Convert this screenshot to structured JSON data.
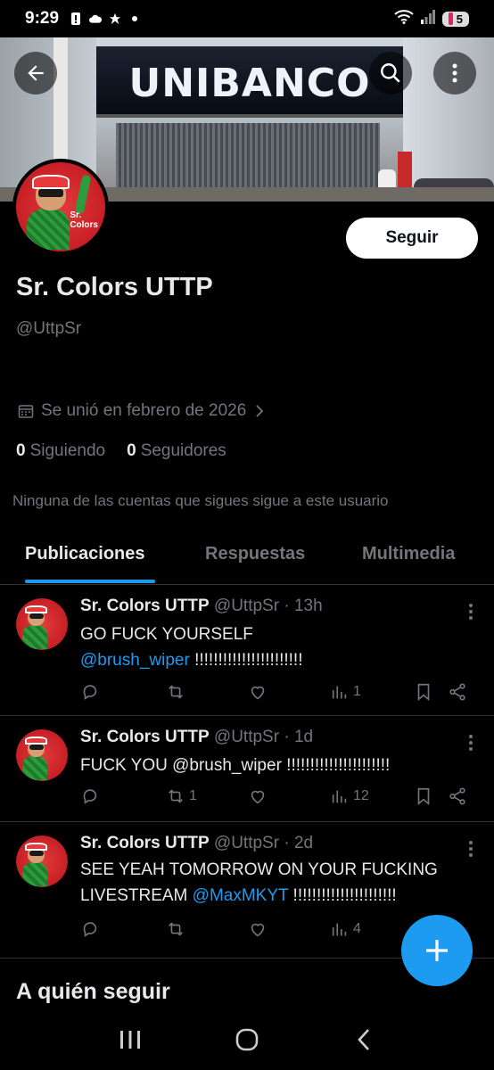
{
  "status": {
    "time": "9:29",
    "battery": "5"
  },
  "profile": {
    "banner_text": "UNIBANCO",
    "avatar_label": "Sr.\nColors",
    "follow_label": "Seguir",
    "display_name": "Sr. Colors UTTP",
    "handle": "@UttpSr",
    "joined": "Se unió en febrero de 2026",
    "following_count": "0",
    "following_label": "Siguiendo",
    "followers_count": "0",
    "followers_label": "Seguidores",
    "mutual_note": "Ninguna de las cuentas que sigues sigue a este usuario"
  },
  "tabs": [
    {
      "label": "Publicaciones",
      "active": true
    },
    {
      "label": "Respuestas",
      "active": false
    },
    {
      "label": "Multimedia",
      "active": false
    }
  ],
  "tweets": [
    {
      "name": "Sr. Colors UTTP",
      "meta": "@UttpSr · 13h",
      "text_before": "GO FUCK YOURSELF",
      "mention": "@brush_wiper",
      "text_after": " !!!!!!!!!!!!!!!!!!!!!!!",
      "replies": "",
      "retweets": "",
      "likes": "",
      "views": "1"
    },
    {
      "name": "Sr. Colors UTTP",
      "meta": "@UttpSr · 1d",
      "text_before": "FUCK YOU @brush_wiper !!!!!!!!!!!!!!!!!!!!!!",
      "mention": "",
      "text_after": "",
      "replies": "",
      "retweets": "1",
      "likes": "",
      "views": "12"
    },
    {
      "name": "Sr. Colors UTTP",
      "meta": "@UttpSr · 2d",
      "text_before": "SEE YEAH TOMORROW ON YOUR FUCKING LIVESTREAM ",
      "mention": "@MaxMKYT",
      "text_after": " !!!!!!!!!!!!!!!!!!!!!!",
      "replies": "",
      "retweets": "",
      "likes": "",
      "views": "4"
    }
  ],
  "who_to_follow": "A quién seguir",
  "colors": {
    "accent": "#1d9bf0",
    "muted": "#71767b",
    "bg": "#000000",
    "text": "#e7e9ea"
  }
}
